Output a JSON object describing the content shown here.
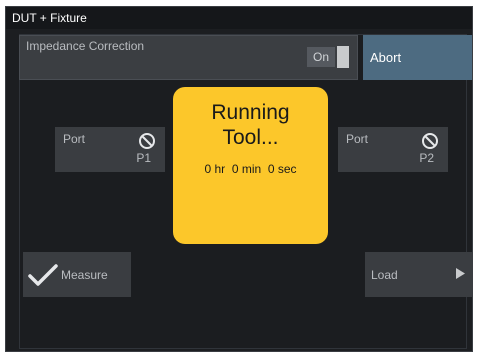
{
  "window": {
    "title": "DUT + Fixture"
  },
  "impedance": {
    "label": "Impedance Correction",
    "toggle_state": "On"
  },
  "abort_label": "Abort",
  "ports": [
    {
      "label": "Port",
      "value": "P1",
      "icon": "no-entry-icon"
    },
    {
      "label": "Port",
      "value": "P2",
      "icon": "no-entry-icon"
    }
  ],
  "status": {
    "title_line1": "Running",
    "title_line2": "Tool...",
    "time": "0 hr  0 min  0 sec"
  },
  "measure_label": "Measure",
  "load_label": "Load",
  "colors": {
    "accent": "#fcc72a",
    "abort": "#4d6b81",
    "background": "#1c1e21",
    "button": "#3a3d41"
  }
}
